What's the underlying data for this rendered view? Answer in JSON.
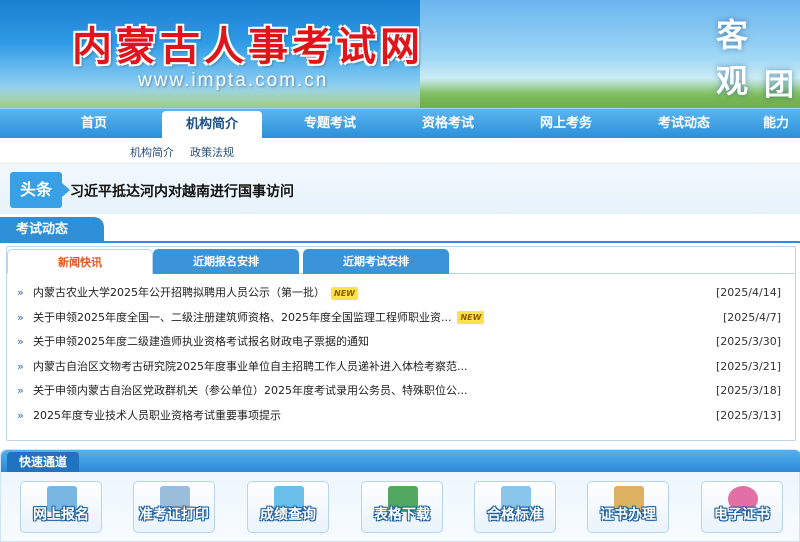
{
  "header": {
    "site_title": "内蒙古人事考试网",
    "url": "www.impta.com.cn",
    "slogan_line1": "客 观",
    "slogan_line2": "团"
  },
  "nav": {
    "items": [
      {
        "label": "首页"
      },
      {
        "label": "机构简介"
      },
      {
        "label": "专题考试"
      },
      {
        "label": "资格考试"
      },
      {
        "label": "网上考务"
      },
      {
        "label": "考试动态"
      },
      {
        "label": "能力"
      }
    ],
    "active": "机构简介"
  },
  "subnav": {
    "items": [
      {
        "label": "机构简介"
      },
      {
        "label": "政策法规"
      }
    ]
  },
  "headline": {
    "badge": "头条",
    "text": "习近平抵达河内对越南进行国事访问"
  },
  "exam_news": {
    "section_title": "考试动态",
    "tabs": [
      {
        "label": "新闻快讯"
      },
      {
        "label": "近期报名安排"
      },
      {
        "label": "近期考试安排"
      }
    ],
    "active_tab": "新闻快讯",
    "new_tag": "NEW",
    "items": [
      {
        "title": "内蒙古农业大学2025年公开招聘拟聘用人员公示（第一批）",
        "date": "[2025/4/14]",
        "is_new": true
      },
      {
        "title": "关于申领2025年度全国一、二级注册建筑师资格、2025年度全国监理工程师职业资...",
        "date": "[2025/4/7]",
        "is_new": true
      },
      {
        "title": "关于申领2025年度二级建造师执业资格考试报名财政电子票据的通知",
        "date": "[2025/3/30]",
        "is_new": false
      },
      {
        "title": "内蒙古自治区文物考古研究院2025年度事业单位自主招聘工作人员递补进入体检考察范...",
        "date": "[2025/3/21]",
        "is_new": false
      },
      {
        "title": "关于申领内蒙古自治区党政群机关（参公单位）2025年度考试录用公务员、特殊职位公...",
        "date": "[2025/3/18]",
        "is_new": false
      },
      {
        "title": "2025年度专业技术人员职业资格考试重要事项提示",
        "date": "[2025/3/13]",
        "is_new": false
      }
    ]
  },
  "quick_access": {
    "title": "快速通道",
    "buttons": [
      {
        "label": "网上报名",
        "icon": "online-register-icon",
        "color": "#6aaee0"
      },
      {
        "label": "准考证打印",
        "icon": "printer-icon",
        "color": "#8fb6d6"
      },
      {
        "label": "成绩查询",
        "icon": "score-query-icon",
        "color": "#58b8e8"
      },
      {
        "label": "表格下载",
        "icon": "excel-download-icon",
        "color": "#3f9e4f"
      },
      {
        "label": "合格标准",
        "icon": "standard-chart-icon",
        "color": "#7cc0e8"
      },
      {
        "label": "证书办理",
        "icon": "certificate-icon",
        "color": "#d9a84e"
      },
      {
        "label": "电子证书",
        "icon": "e-certificate-icon",
        "color": "#e0609a"
      }
    ]
  }
}
